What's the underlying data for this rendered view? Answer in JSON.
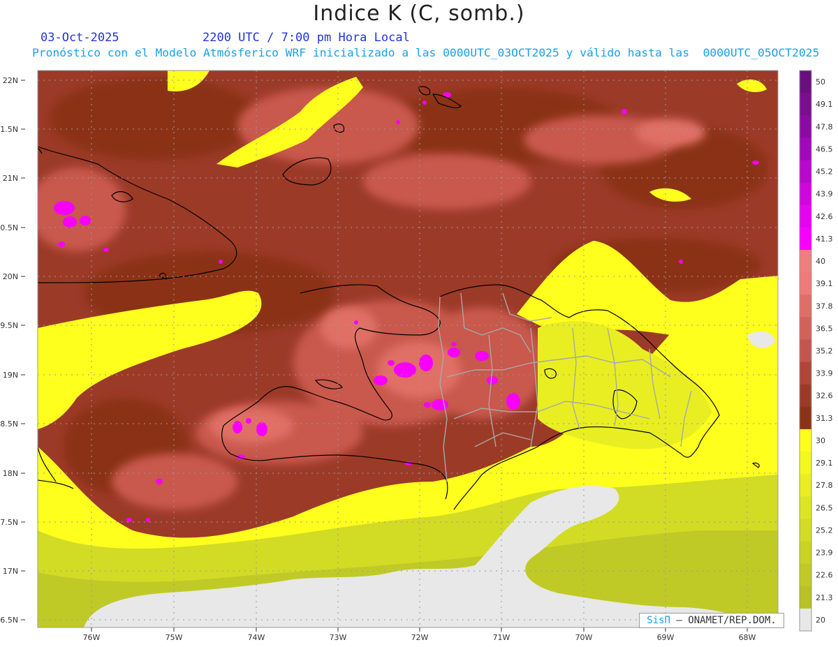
{
  "title": "Indice K (C, somb.)",
  "header": {
    "date": "03-Oct-2025",
    "valid_time": "2200 UTC / 7:00 pm Hora Local",
    "forecast_note": "Pronóstico con el Modelo Atmósferico WRF inicializado a las 0000UTC_03OCT2025 y válido hasta las  0000UTC_05OCT2025"
  },
  "axes": {
    "lat_labels": [
      "22N",
      "1.5N",
      "21N",
      "0.5N",
      "20N",
      "9.5N",
      "19N",
      "8.5N",
      "18N",
      "7.5N",
      "17N",
      "6.5N"
    ],
    "lon_labels": [
      "76W",
      "75W",
      "74W",
      "73W",
      "72W",
      "71W",
      "70W",
      "69W",
      "68W"
    ]
  },
  "legend": {
    "levels": [
      {
        "label": "50",
        "color": "#6a0f7d"
      },
      {
        "label": "49.1",
        "color": "#7b0e8f"
      },
      {
        "label": "47.8",
        "color": "#8c0aa3"
      },
      {
        "label": "46.5",
        "color": "#a009b8"
      },
      {
        "label": "45.2",
        "color": "#b808cc"
      },
      {
        "label": "43.9",
        "color": "#cf06de"
      },
      {
        "label": "42.6",
        "color": "#e404ef"
      },
      {
        "label": "41.3",
        "color": "#f600fb"
      },
      {
        "label": "40",
        "color": "#ef7e7e"
      },
      {
        "label": "39.1",
        "color": "#ee7a7a"
      },
      {
        "label": "37.8",
        "color": "#e06e66"
      },
      {
        "label": "36.5",
        "color": "#d2615a"
      },
      {
        "label": "35.2",
        "color": "#c4554e"
      },
      {
        "label": "33.9",
        "color": "#b04538"
      },
      {
        "label": "32.6",
        "color": "#9c3a28"
      },
      {
        "label": "31.3",
        "color": "#8b3317"
      },
      {
        "label": "30",
        "color": "#ffff1e"
      },
      {
        "label": "29.1",
        "color": "#f3f81f"
      },
      {
        "label": "27.8",
        "color": "#e8ee22"
      },
      {
        "label": "26.5",
        "color": "#dce524"
      },
      {
        "label": "25.2",
        "color": "#d2dc25"
      },
      {
        "label": "23.9",
        "color": "#c9d326"
      },
      {
        "label": "22.6",
        "color": "#c0ca26"
      },
      {
        "label": "21.3",
        "color": "#b8c126"
      },
      {
        "label": "20",
        "color": "#e8e8e8"
      }
    ]
  },
  "credit": {
    "brand": "SisΠ",
    "text": "– ONAMET/REP.DOM."
  }
}
